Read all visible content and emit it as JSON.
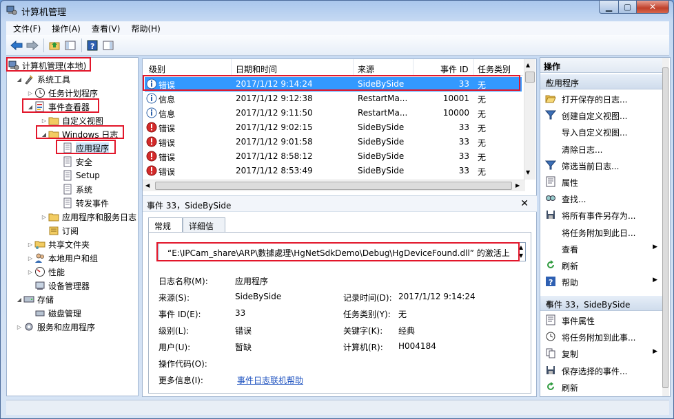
{
  "window": {
    "title": "计算机管理"
  },
  "menu": [
    {
      "label": "文件(F)"
    },
    {
      "label": "操作(A)"
    },
    {
      "label": "查看(V)"
    },
    {
      "label": "帮助(H)"
    }
  ],
  "tree": [
    {
      "label": "计算机管理(本地)",
      "icon": "computer-icon",
      "level": 0,
      "arrow": "",
      "highlight": true
    },
    {
      "label": "系统工具",
      "icon": "tools-icon",
      "level": 1,
      "arrow": "down",
      "highlight": false
    },
    {
      "label": "任务计划程序",
      "icon": "clock-icon",
      "level": 2,
      "arrow": "right",
      "highlight": false
    },
    {
      "label": "事件查看器",
      "icon": "event-viewer-icon",
      "level": 2,
      "arrow": "down",
      "highlight": true
    },
    {
      "label": "自定义视图",
      "icon": "folder-icon",
      "level": 3,
      "arrow": "right",
      "highlight": false
    },
    {
      "label": "Windows 日志",
      "icon": "folder-icon",
      "level": 3,
      "arrow": "down",
      "highlight": true
    },
    {
      "label": "应用程序",
      "icon": "log-icon",
      "level": 4,
      "arrow": "",
      "highlight": true
    },
    {
      "label": "安全",
      "icon": "log-icon",
      "level": 4,
      "arrow": "",
      "highlight": false
    },
    {
      "label": "Setup",
      "icon": "log-icon",
      "level": 4,
      "arrow": "",
      "highlight": false
    },
    {
      "label": "系统",
      "icon": "log-icon",
      "level": 4,
      "arrow": "",
      "highlight": false
    },
    {
      "label": "转发事件",
      "icon": "log-icon",
      "level": 4,
      "arrow": "",
      "highlight": false
    },
    {
      "label": "应用程序和服务日志",
      "icon": "folder-icon",
      "level": 3,
      "arrow": "right",
      "highlight": false
    },
    {
      "label": "订阅",
      "icon": "subscription-icon",
      "level": 3,
      "arrow": "",
      "highlight": false
    },
    {
      "label": "共享文件夹",
      "icon": "shared-folder-icon",
      "level": 2,
      "arrow": "right",
      "highlight": false
    },
    {
      "label": "本地用户和组",
      "icon": "users-icon",
      "level": 2,
      "arrow": "right",
      "highlight": false
    },
    {
      "label": "性能",
      "icon": "performance-icon",
      "level": 2,
      "arrow": "right",
      "highlight": false
    },
    {
      "label": "设备管理器",
      "icon": "device-manager-icon",
      "level": 2,
      "arrow": "",
      "highlight": false
    },
    {
      "label": "存储",
      "icon": "storage-icon",
      "level": 1,
      "arrow": "down",
      "highlight": false
    },
    {
      "label": "磁盘管理",
      "icon": "disk-icon",
      "level": 2,
      "arrow": "",
      "highlight": false
    },
    {
      "label": "服务和应用程序",
      "icon": "services-icon",
      "level": 1,
      "arrow": "right",
      "highlight": false
    }
  ],
  "grid": {
    "columns": [
      "级别",
      "日期和时间",
      "来源",
      "事件 ID",
      "任务类别"
    ],
    "rows": [
      {
        "level": "错误",
        "type": "info",
        "datetime": "2017/1/12 9:14:24",
        "source": "SideBySide",
        "id": "33",
        "category": "无"
      },
      {
        "level": "信息",
        "type": "info",
        "datetime": "2017/1/12 9:12:38",
        "source": "RestartMa...",
        "id": "10001",
        "category": "无"
      },
      {
        "level": "信息",
        "type": "info",
        "datetime": "2017/1/12 9:11:50",
        "source": "RestartMa...",
        "id": "10000",
        "category": "无"
      },
      {
        "level": "错误",
        "type": "error",
        "datetime": "2017/1/12 9:02:15",
        "source": "SideBySide",
        "id": "33",
        "category": "无"
      },
      {
        "level": "错误",
        "type": "error",
        "datetime": "2017/1/12 9:01:58",
        "source": "SideBySide",
        "id": "33",
        "category": "无"
      },
      {
        "level": "错误",
        "type": "error",
        "datetime": "2017/1/12 8:58:12",
        "source": "SideBySide",
        "id": "33",
        "category": "无"
      },
      {
        "level": "错误",
        "type": "error",
        "datetime": "2017/1/12 8:53:49",
        "source": "SideBySide",
        "id": "33",
        "category": "无"
      }
    ]
  },
  "event": {
    "header": "事件 33，SideBySide",
    "tabs": [
      "常规",
      "详细信息"
    ],
    "description": "“E:\\IPCam_share\\ARP\\數據處理\\HgNetSdkDemo\\Debug\\HgDeviceFound.dll” 的激活上",
    "labels": {
      "log_name": "日志名称(M):",
      "source": "来源(S):",
      "event_id": "事件 ID(E):",
      "level": "级别(L):",
      "user": "用户(U):",
      "opcode": "操作代码(O):",
      "more_info": "更多信息(I):",
      "logged": "记录时间(D):",
      "task_category": "任务类别(Y):",
      "keywords": "关键字(K):",
      "computer": "计算机(R):"
    },
    "values": {
      "log_name": "应用程序",
      "source": "SideBySide",
      "event_id": "33",
      "level": "错误",
      "user": "暂缺",
      "more_info_link": "事件日志联机帮助",
      "logged": "2017/1/12 9:14:24",
      "task_category": "无",
      "keywords": "经典",
      "computer": "H004184"
    }
  },
  "actions": {
    "title": "操作",
    "section1": "应用程序",
    "items1": [
      {
        "label": "打开保存的日志...",
        "icon": "folder-open-icon",
        "sub": false
      },
      {
        "label": "创建自定义视图...",
        "icon": "filter-icon",
        "sub": false
      },
      {
        "label": "导入自定义视图...",
        "icon": "",
        "sub": false
      },
      {
        "label": "清除日志...",
        "icon": "",
        "sub": false
      },
      {
        "label": "筛选当前日志...",
        "icon": "filter-icon",
        "sub": false
      },
      {
        "label": "属性",
        "icon": "properties-icon",
        "sub": false
      },
      {
        "label": "查找...",
        "icon": "find-icon",
        "sub": false
      },
      {
        "label": "将所有事件另存为...",
        "icon": "save-icon",
        "sub": false
      },
      {
        "label": "将任务附加到此日...",
        "icon": "",
        "sub": false
      },
      {
        "label": "查看",
        "icon": "",
        "sub": true
      },
      {
        "label": "刷新",
        "icon": "refresh-icon",
        "sub": false
      },
      {
        "label": "帮助",
        "icon": "help-icon",
        "sub": true
      }
    ],
    "section2": "事件 33，SideBySide",
    "items2": [
      {
        "label": "事件属性",
        "icon": "properties-icon",
        "sub": false
      },
      {
        "label": "将任务附加到此事...",
        "icon": "task-icon",
        "sub": false
      },
      {
        "label": "复制",
        "icon": "copy-icon",
        "sub": true
      },
      {
        "label": "保存选择的事件...",
        "icon": "save-icon",
        "sub": false
      },
      {
        "label": "刷新",
        "icon": "refresh-icon",
        "sub": false
      }
    ]
  }
}
